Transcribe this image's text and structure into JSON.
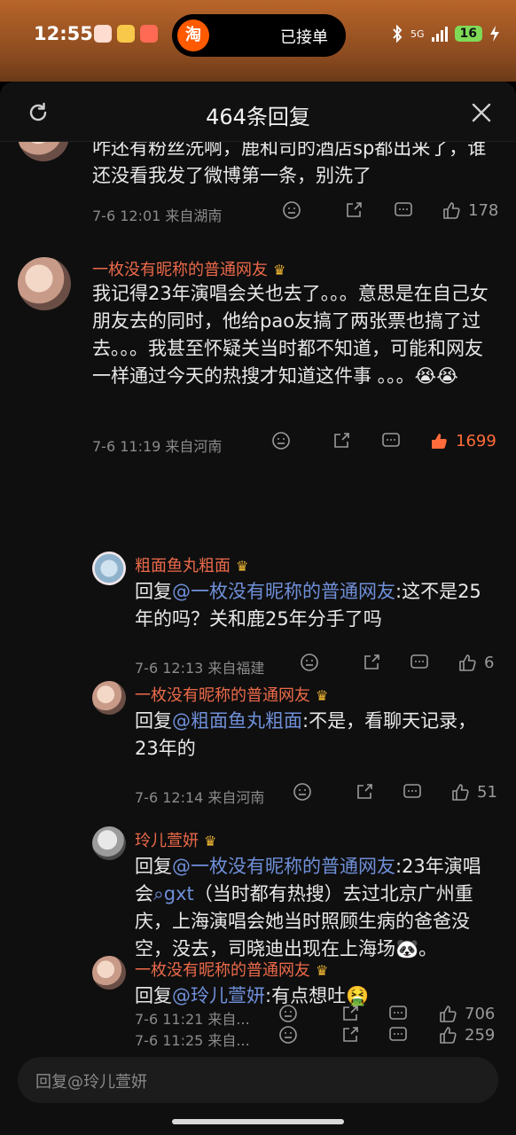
{
  "status": {
    "time": "12:55",
    "island_app": "淘",
    "island_text": "已接单",
    "network": "5G",
    "battery": "16"
  },
  "sheet": {
    "title": "464条回复"
  },
  "comments": [
    {
      "text": "咋还有粉丝洗啊，鹿和司的酒店sp都出来了，谁还没看我发了微博第一条，别洗了",
      "meta": "7-6 12:01 来自湖南",
      "likes": "178"
    },
    {
      "name": "一枚没有昵称的普通网友",
      "text": "我记得23年演唱会关也去了。。。意思是在自己女朋友去的同时，他给pao友搞了两张票也搞了过去。。。我甚至怀疑关当时都不知道，可能和网友一样通过今天的热搜才知道这件事 。。。😭😭",
      "meta": "7-6 11:19 来自河南",
      "likes": "1699"
    },
    {
      "name": "粗面鱼丸粗面",
      "reply_prefix": "回复",
      "mention": "@一枚没有昵称的普通网友",
      "text": ":这不是25年的吗？关和鹿25年分手了吗",
      "meta": "7-6 12:13 来自福建",
      "likes": "6"
    },
    {
      "name": "一枚没有昵称的普通网友",
      "reply_prefix": "回复",
      "mention": "@粗面鱼丸粗面",
      "text": ":不是，看聊天记录，23年的",
      "meta": "7-6 12:14 来自河南",
      "likes": "51"
    },
    {
      "name": "玲儿萱妍",
      "reply_prefix": "回复",
      "mention": "@一枚没有昵称的普通网友",
      "text_a": ":23年演唱会",
      "search_chip": "gxt",
      "text_b": "（当时都有热搜）去过北京广州重庆，上海演唱会她当时照顾生病的爸爸没空，没去，司晓迪出现在上海场🐼。",
      "meta": "7-6 11:21 来自...",
      "likes": "706"
    },
    {
      "name": "一枚没有昵称的普通网友",
      "reply_prefix": "回复",
      "mention": "@玲儿萱妍",
      "text": ":有点想吐🤮",
      "meta": "7-6 11:25 来自...",
      "likes": "259"
    }
  ],
  "reply_bar": {
    "placeholder": "回复@玲儿萱妍"
  },
  "colors": {
    "name": "#ec6a4a",
    "mention": "#6f8fd8",
    "liked": "#ff6b3a",
    "background": "#0f0f0f"
  },
  "icons": [
    "refresh-icon",
    "close-icon",
    "emoji-icon",
    "share-icon",
    "comment-icon",
    "like-icon",
    "crown-icon"
  ]
}
